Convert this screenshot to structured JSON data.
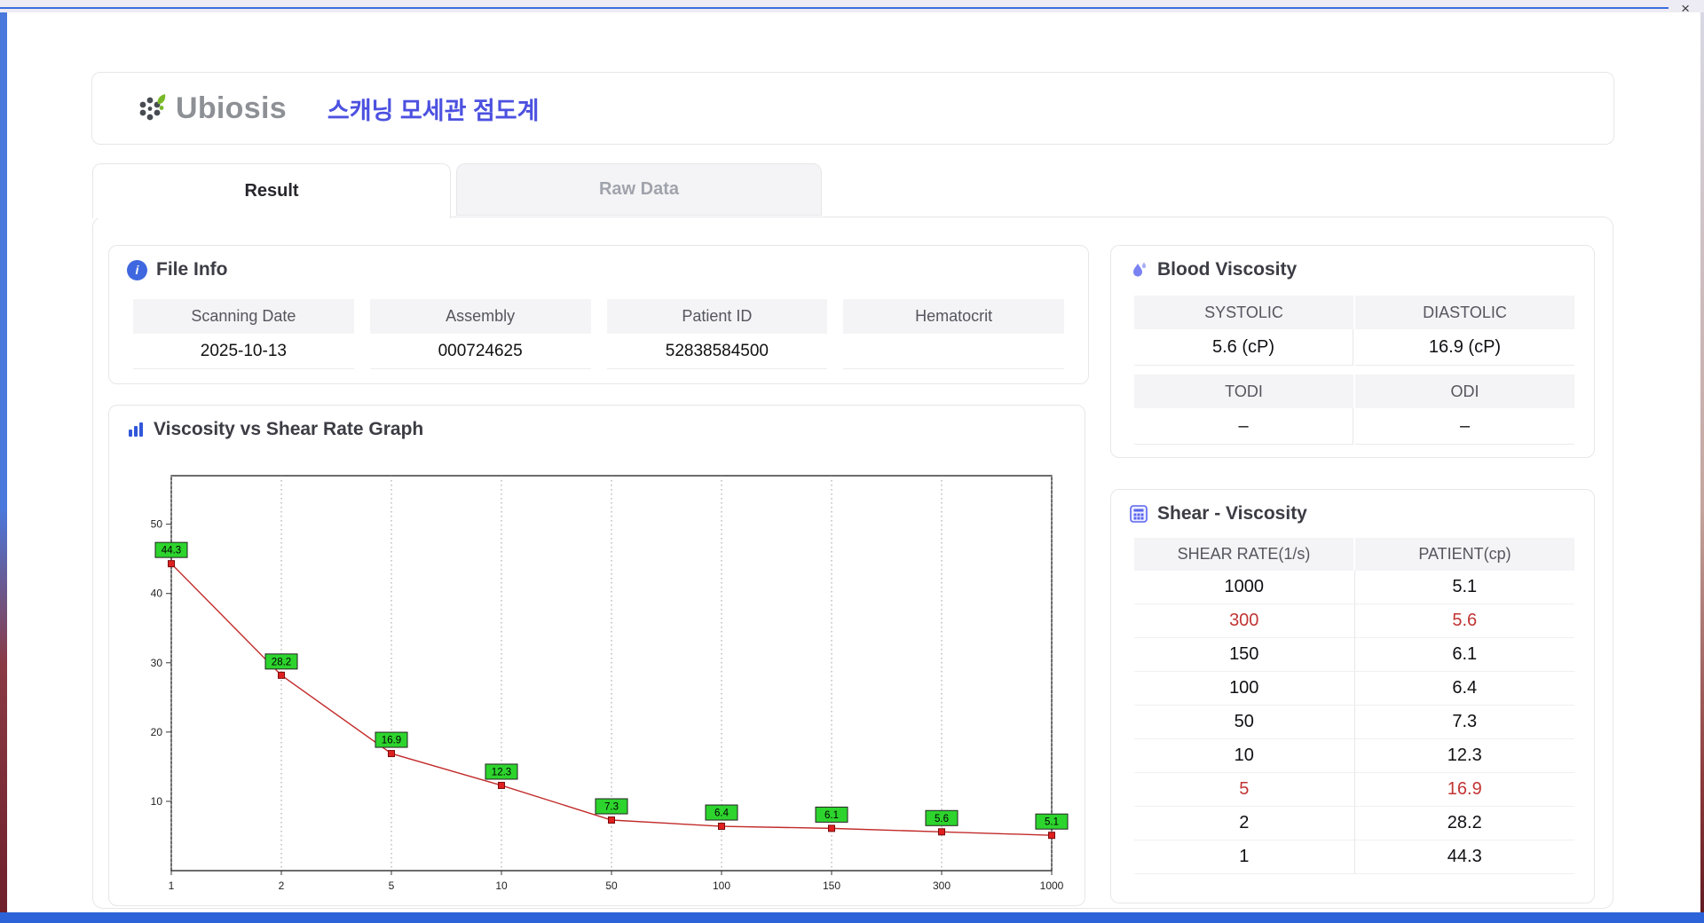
{
  "window": {
    "close_label": "×"
  },
  "header": {
    "brand": "Ubiosis",
    "title": "스캐닝 모세관 점도계"
  },
  "tabs": {
    "result": "Result",
    "raw_data": "Raw Data"
  },
  "file_info": {
    "title": "File Info",
    "fields": [
      {
        "label": "Scanning Date",
        "value": "2025-10-13"
      },
      {
        "label": "Assembly",
        "value": "000724625"
      },
      {
        "label": "Patient ID",
        "value": "52838584500"
      },
      {
        "label": "Hematocrit",
        "value": ""
      }
    ]
  },
  "blood_viscosity": {
    "title": "Blood Viscosity",
    "groups": [
      {
        "labels": [
          "SYSTOLIC",
          "DIASTOLIC"
        ],
        "values": [
          "5.6 (cP)",
          "16.9 (cP)"
        ]
      },
      {
        "labels": [
          "TODI",
          "ODI"
        ],
        "values": [
          "–",
          "–"
        ]
      }
    ]
  },
  "shear_viscosity": {
    "title": "Shear - Viscosity",
    "columns": [
      "SHEAR RATE(1/s)",
      "PATIENT(cp)"
    ],
    "rows": [
      {
        "shear": "1000",
        "patient": "5.1",
        "highlight": false
      },
      {
        "shear": "300",
        "patient": "5.6",
        "highlight": true
      },
      {
        "shear": "150",
        "patient": "6.1",
        "highlight": false
      },
      {
        "shear": "100",
        "patient": "6.4",
        "highlight": false
      },
      {
        "shear": "50",
        "patient": "7.3",
        "highlight": false
      },
      {
        "shear": "10",
        "patient": "12.3",
        "highlight": false
      },
      {
        "shear": "5",
        "patient": "16.9",
        "highlight": true
      },
      {
        "shear": "2",
        "patient": "28.2",
        "highlight": false
      },
      {
        "shear": "1",
        "patient": "44.3",
        "highlight": false
      }
    ]
  },
  "chart_data": {
    "type": "line",
    "title": "Viscosity vs Shear Rate Graph",
    "x_categories": [
      "1",
      "2",
      "5",
      "10",
      "50",
      "100",
      "150",
      "300",
      "1000"
    ],
    "values": [
      44.3,
      28.2,
      16.9,
      12.3,
      7.3,
      6.4,
      6.1,
      5.6,
      5.1
    ],
    "yticks": [
      10,
      20,
      30,
      40,
      50
    ],
    "ylim": [
      0,
      57
    ],
    "x_scale": "categorical",
    "grid": "vertical-dotted",
    "legend": "none",
    "line_color": "#c22b2b",
    "marker_color": "#e02020",
    "point_label_bg": "#2dd42d"
  }
}
